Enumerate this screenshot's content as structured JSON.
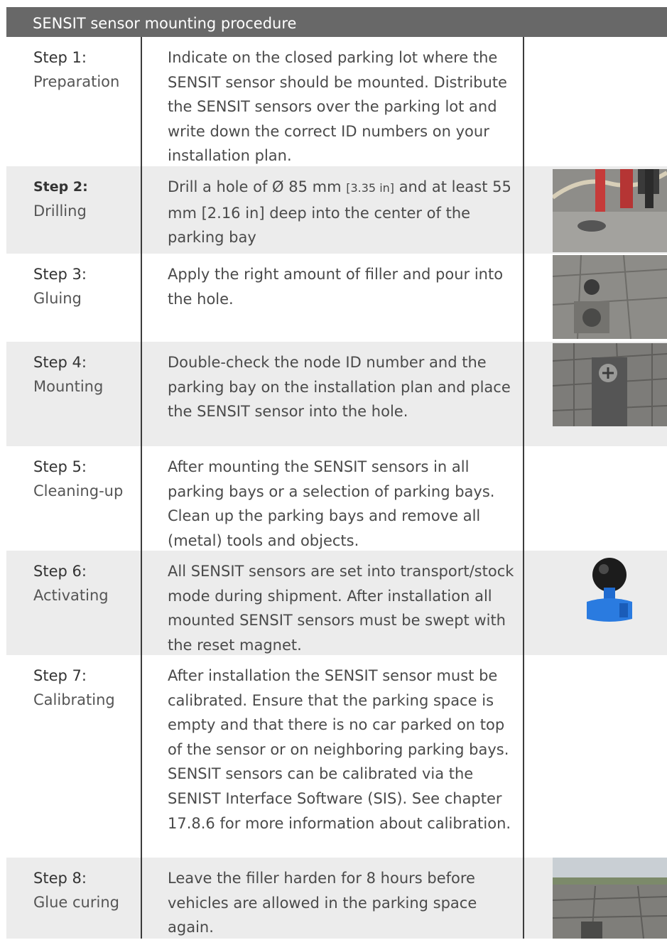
{
  "table": {
    "title": "SENSIT sensor mounting procedure",
    "rows": [
      {
        "step": "Step 1:",
        "name": "Preparation",
        "desc": "Indicate on the closed parking lot where the SENSIT sensor should be mounted. Distribute the SENSIT sensors over the parking lot and write down the correct ID numbers on your installation plan."
      },
      {
        "step": "Step 2:",
        "name": "Drilling",
        "desc_a": "Drill a hole of Ø 85 mm ",
        "desc_small": "[3.35 in]",
        "desc_b": " and at least 55 mm [2.16 in] deep into the center of the parking bay",
        "image": "drilling-photo"
      },
      {
        "step": "Step 3:",
        "name": "Gluing",
        "desc": "Apply the right amount of filler and pour into the hole.",
        "image": "gluing-photo"
      },
      {
        "step": "Step 4:",
        "name": "Mounting",
        "desc": "Double-check the node ID number and the parking bay on the installation plan and place the SENSIT sensor into the hole.",
        "image": "mounting-photo"
      },
      {
        "step": "Step 5:",
        "name": "Cleaning-up",
        "desc": "After mounting the SENSIT sensors in all parking bays or a selection of parking bays. Clean up the parking bays and remove all (metal) tools and objects."
      },
      {
        "step": "Step 6:",
        "name": "Activating",
        "desc": "All SENSIT sensors are set into transport/stock mode during shipment. After installation all mounted SENSIT sensors must be swept with the reset magnet.",
        "image": "reset-magnet-image"
      },
      {
        "step": "Step 7:",
        "name": "Calibrating",
        "desc": "After installation the SENSIT sensor must be calibrated. Ensure that the parking space is empty and that there is no car parked on top of the sensor or on neighboring parking bays. SENSIT sensors can be calibrated via the SENIST Interface Software (SIS). See chapter 17.8.6 for more information about calibration."
      },
      {
        "step": "Step 8:",
        "name": "Glue curing",
        "desc": "Leave the filler harden for 8 hours before vehicles are allowed in the parking space again.",
        "image": "parking-lot-photo"
      }
    ]
  }
}
